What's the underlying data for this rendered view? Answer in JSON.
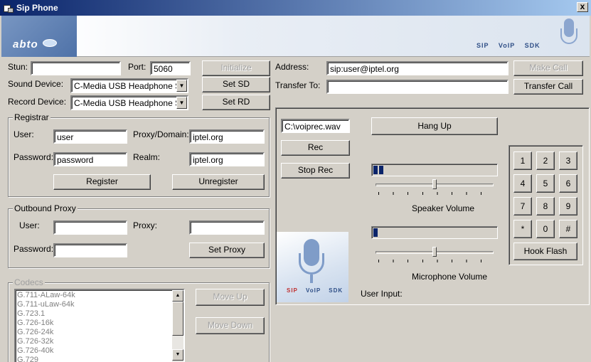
{
  "window": {
    "title": "Sip Phone",
    "close_glyph": "x"
  },
  "banner": {
    "logo_text": "abto",
    "brand_sip": "SIP",
    "brand_voip": "VoIP",
    "brand_sdk": "SDK"
  },
  "config": {
    "stun_label": "Stun:",
    "stun_value": "",
    "port_label": "Port:",
    "port_value": "5060",
    "initialize_label": "Initialize",
    "sound_device_label": "Sound Device:",
    "sound_device_value": "C-Media USB Headphone Set",
    "set_sd_label": "Set SD",
    "record_device_label": "Record Device:",
    "record_device_value": "C-Media USB Headphone Set",
    "set_rd_label": "Set RD"
  },
  "registrar": {
    "title": "Registrar",
    "user_label": "User:",
    "user_value": "user",
    "proxy_domain_label": "Proxy/Domain:",
    "proxy_domain_value": "iptel.org",
    "password_label": "Password:",
    "password_value": "password",
    "realm_label": "Realm:",
    "realm_value": "iptel.org",
    "register_label": "Register",
    "unregister_label": "Unregister"
  },
  "outbound_proxy": {
    "title": "Outbound Proxy",
    "user_label": "User:",
    "user_value": "",
    "proxy_label": "Proxy:",
    "proxy_value": "",
    "password_label": "Password:",
    "password_value": "",
    "set_proxy_label": "Set Proxy"
  },
  "codecs": {
    "title": "Codecs",
    "items": [
      "G.711-ALaw-64k",
      "G.711-uLaw-64k",
      "G.723.1",
      "G.726-16k",
      "G.726-24k",
      "G.726-32k",
      "G.726-40k",
      "G.729"
    ],
    "move_up_label": "Move Up",
    "move_down_label": "Move Down"
  },
  "call": {
    "address_label": "Address:",
    "address_value": "sip:user@iptel.org",
    "make_call_label": "Make Call",
    "transfer_to_label": "Transfer To:",
    "transfer_to_value": "",
    "transfer_call_label": "Transfer Call"
  },
  "recording": {
    "file_value": "C:\\voiprec.wav",
    "rec_label": "Rec",
    "stop_rec_label": "Stop Rec",
    "hang_up_label": "Hang Up"
  },
  "audio": {
    "speaker_level_segments": 2,
    "speaker_volume_fraction": 0.5,
    "speaker_volume_label": "Speaker Volume",
    "mic_level_segments": 1,
    "mic_volume_fraction": 0.5,
    "microphone_volume_label": "Microphone Volume",
    "user_input_label": "User Input:"
  },
  "keypad": {
    "keys": [
      "1",
      "2",
      "3",
      "4",
      "5",
      "6",
      "7",
      "8",
      "9",
      "*",
      "0",
      "#"
    ],
    "hook_flash_label": "Hook Flash"
  },
  "colors": {
    "face": "#d4d0c8",
    "titlebar_start": "#0a246a",
    "meter_fill": "#0a246a",
    "brand_red": "#c03030"
  }
}
